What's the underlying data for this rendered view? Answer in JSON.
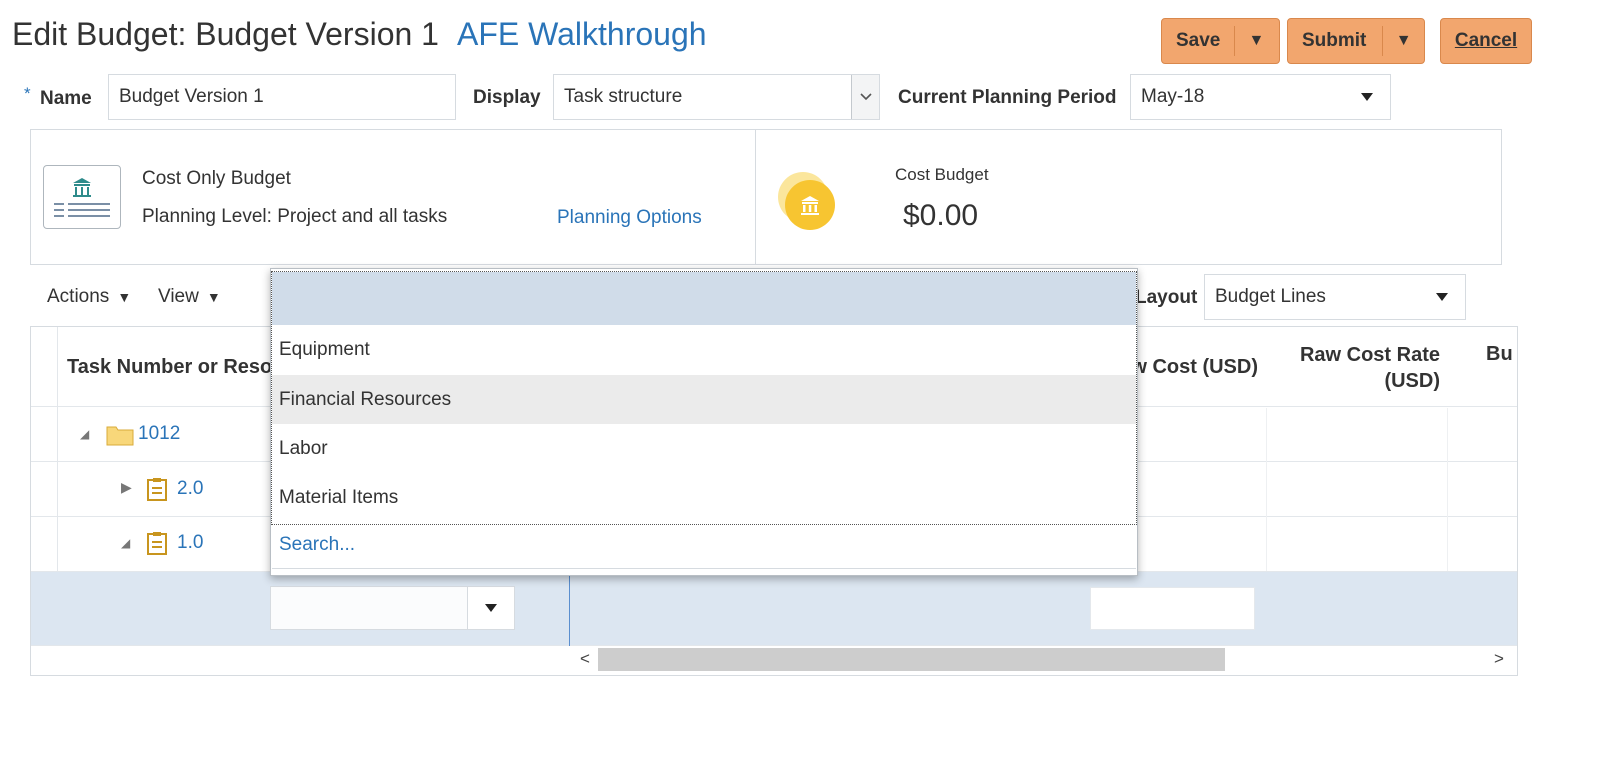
{
  "header": {
    "title": "Edit Budget: Budget Version 1",
    "project": "AFE Walkthrough"
  },
  "buttons": {
    "save": "Save",
    "submit": "Submit",
    "cancel": "Cancel"
  },
  "form": {
    "required_mark": "*",
    "name_label": "Name",
    "name_value": "Budget Version 1",
    "display_label": "Display",
    "display_value": "Task structure",
    "period_label": "Current Planning Period",
    "period_value": "May-18"
  },
  "info": {
    "budget_type": "Cost Only Budget",
    "planning_level": "Planning Level: Project and all tasks",
    "planning_options": "Planning Options",
    "cost_label": "Cost Budget",
    "cost_value": "$0.00"
  },
  "toolbar": {
    "actions": "Actions",
    "view": "View",
    "layout_label": "Layout",
    "layout_value": "Budget Lines"
  },
  "table": {
    "col_task": "Task Number or Resource",
    "col_raw_cost": "Raw Cost (USD)",
    "col_raw_rate_1": "Raw Cost Rate",
    "col_raw_rate_2": "(USD)",
    "col_bu": "Bu",
    "rows": [
      {
        "label": "1012"
      },
      {
        "label": "2.0"
      },
      {
        "label": "1.0"
      }
    ]
  },
  "dropdown": {
    "items": [
      "Equipment",
      "Financial Resources",
      "Labor",
      "Material Items"
    ],
    "highlighted": "Financial Resources",
    "search": "Search..."
  },
  "colors": {
    "accent_button": "#f2a66e",
    "link": "#2a74b8",
    "selected_row": "#dce6f1",
    "menu_header": "#d0dce9"
  },
  "icons": {
    "budget": "bank-document-icon",
    "cost": "coin-bank-icon",
    "folder": "folder-icon",
    "task": "clipboard-icon",
    "expand": "triangle-down-icon",
    "collapse": "triangle-right-icon"
  }
}
